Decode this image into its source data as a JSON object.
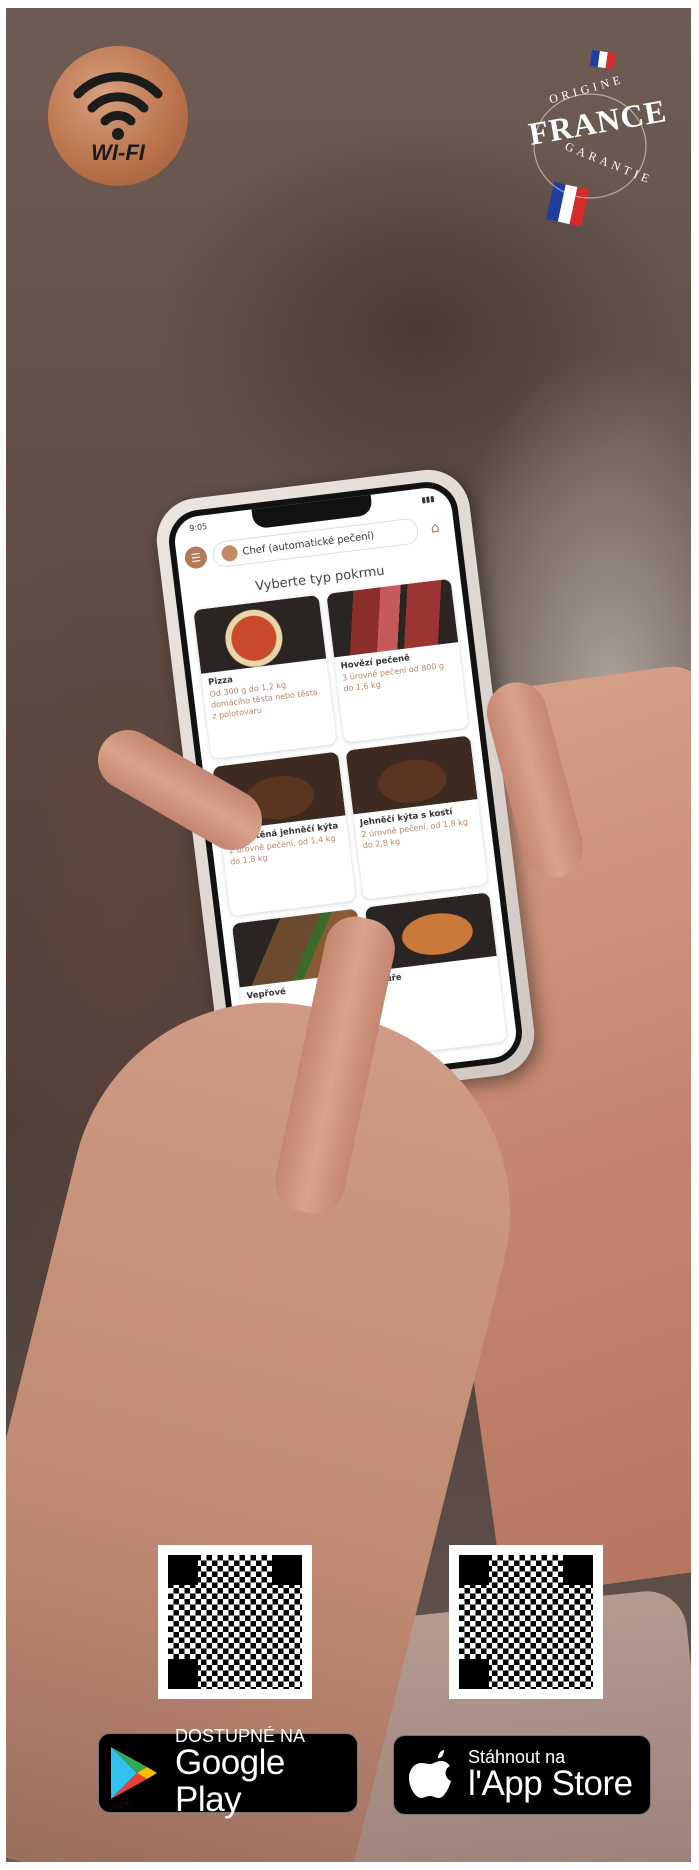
{
  "badges": {
    "wifi_label": "WI-FI",
    "origin_top": "ORIGINE",
    "origin_country": "FRANCE",
    "origin_bottom": "GARANTIE"
  },
  "phone": {
    "status_time": "9:05",
    "mode_label": "Chef (automatické pečení)",
    "screen_title": "Vyberte typ pokrmu",
    "cards": [
      {
        "name": "Pizza",
        "desc": "Od 300 g do 1,2 kg domácího těsta nebo těsta z polotovaru",
        "image": "pizza"
      },
      {
        "name": "Hovězí pečeně",
        "desc": "3 úrovně pečení od 800 g do 1,6 kg",
        "image": "beef"
      },
      {
        "name": "Vykostěná jehněčí kýta",
        "desc": "2 úrovně pečení, od 1,4 kg do 1,8 kg",
        "image": "lamb"
      },
      {
        "name": "Jehněčí kýta s kostí",
        "desc": "2 úrovně pečení, od 1,8 kg do 2,8 kg",
        "image": "lamb-bone"
      },
      {
        "name": "Vepřové",
        "desc": "",
        "image": "pork"
      },
      {
        "name": "Kuře",
        "desc": "",
        "image": "chicken"
      }
    ]
  },
  "stores": {
    "google": {
      "small": "DOSTUPNÉ NA",
      "big": "Google Play"
    },
    "apple": {
      "small": "Stáhnout na",
      "big": "l'App Store"
    }
  },
  "colors": {
    "copper": "#b9714a",
    "accent_text": "#b8866a"
  }
}
